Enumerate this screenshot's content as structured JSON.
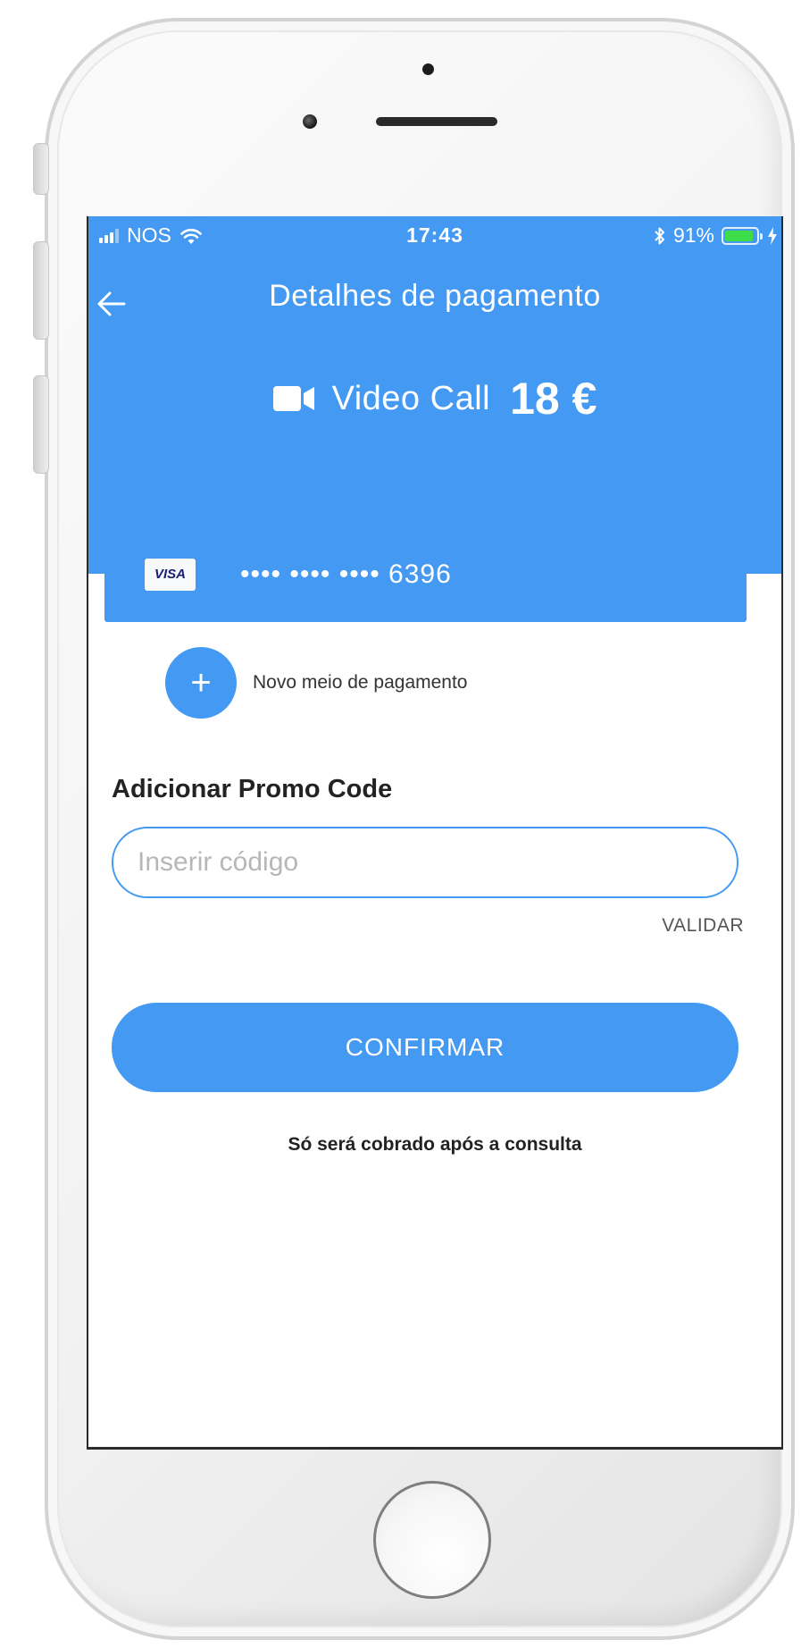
{
  "status_bar": {
    "carrier": "NOS",
    "time": "17:43",
    "battery_percent": "91%",
    "battery_level": 0.91,
    "icons": [
      "signal-icon",
      "wifi-icon",
      "bluetooth-icon",
      "battery-icon",
      "charging-icon"
    ]
  },
  "nav": {
    "back_icon": "arrow-left-icon",
    "title": "Detalhes de pagamento"
  },
  "service": {
    "icon": "video-camera-icon",
    "label": "Video Call",
    "price": "18 €"
  },
  "payment_card": {
    "brand": "VISA",
    "masked_number": "•••• •••• •••• 6396"
  },
  "add_payment": {
    "icon": "plus-icon",
    "plus_symbol": "+",
    "label": "Novo meio de pagamento"
  },
  "promo": {
    "title": "Adicionar Promo Code",
    "placeholder": "Inserir código",
    "value": "",
    "validate_label": "VALIDAR"
  },
  "confirm": {
    "label": "CONFIRMAR",
    "note": "Só será cobrado após a consulta"
  },
  "colors": {
    "primary": "#4499f2",
    "battery_fill": "#3fdc4a",
    "text_dark": "#222222",
    "placeholder": "#b7b7b7"
  }
}
